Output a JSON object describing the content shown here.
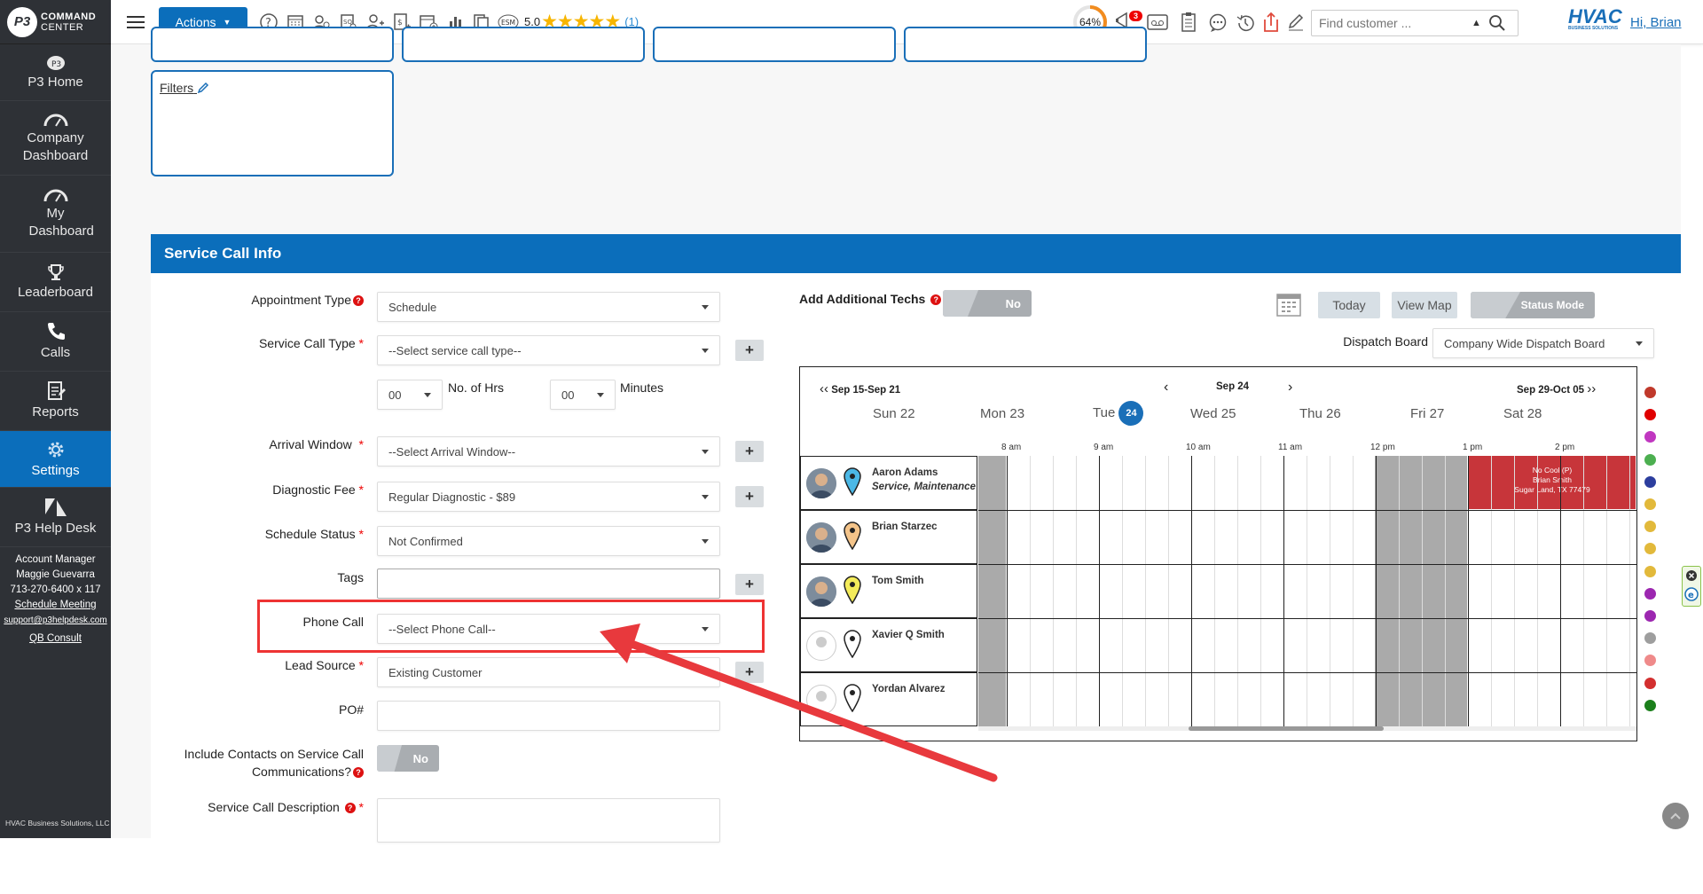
{
  "sidebar": {
    "logo_p3": "P3",
    "logo_line1": "COMMAND",
    "logo_line2": "CENTER",
    "items": [
      {
        "label": "P3 Home"
      },
      {
        "label": "Company Dashboard"
      },
      {
        "label": "My Dashboard"
      },
      {
        "label": "Leaderboard"
      },
      {
        "label": "Calls"
      },
      {
        "label": "Reports"
      },
      {
        "label": "Settings"
      },
      {
        "label": "P3 Help Desk"
      }
    ],
    "account": {
      "title": "Account Manager",
      "name": "Maggie Guevarra",
      "phone": "713-270-6400 x 117",
      "schedule": "Schedule Meeting",
      "email": "support@p3helpdesk.com",
      "qb": "QB Consult"
    },
    "copyright": "HVAC Business Solutions, LLC"
  },
  "topbar": {
    "actions_label": "Actions",
    "rating_value": "5.0",
    "rating_count": "(1)",
    "progress_text": "64%",
    "progress_value": 0.64,
    "notif_count": "3",
    "search_placeholder": "Find customer ...",
    "brand": "HVAC",
    "brand_sub": "BUSINESS SOLUTIONS",
    "greeting": "Hi, Brian"
  },
  "filters": {
    "label": "Filters"
  },
  "section": {
    "title": "Service Call Info"
  },
  "form": {
    "appointment_type": {
      "label": "Appointment Type",
      "value": "Schedule"
    },
    "service_call_type": {
      "label": "Service Call Type",
      "value": "--Select service call type--"
    },
    "hours": {
      "value": "00",
      "label": "No. of Hrs"
    },
    "minutes": {
      "value": "00",
      "label": "Minutes"
    },
    "arrival_window": {
      "label": "Arrival Window",
      "value": "--Select Arrival Window--"
    },
    "diagnostic_fee": {
      "label": "Diagnostic Fee",
      "value": "Regular Diagnostic - $89"
    },
    "schedule_status": {
      "label": "Schedule Status",
      "value": "Not Confirmed"
    },
    "tags": {
      "label": "Tags",
      "value": ""
    },
    "phone_call": {
      "label": "Phone Call",
      "value": "--Select Phone Call--"
    },
    "lead_source": {
      "label": "Lead Source",
      "value": "Existing Customer"
    },
    "po": {
      "label": "PO#",
      "value": ""
    },
    "include_contacts": {
      "label_line1": "Include Contacts on Service Call",
      "label_line2": "Communications?",
      "toggle": "No"
    },
    "description": {
      "label": "Service Call Description"
    }
  },
  "dispatch": {
    "add_techs_label": "Add Additional Techs",
    "add_techs_toggle": "No",
    "today": "Today",
    "view_map": "View Map",
    "status_mode": "Status Mode",
    "board_label": "Dispatch Board",
    "board_value": "Company Wide Dispatch Board",
    "prev_week": "Sep 15-Sep 21",
    "current": "Sep 24",
    "next_week": "Sep 29-Oct 05",
    "days": [
      {
        "name": "Sun",
        "num": "22"
      },
      {
        "name": "Mon",
        "num": "23"
      },
      {
        "name": "Tue",
        "num": "24"
      },
      {
        "name": "Wed",
        "num": "25"
      },
      {
        "name": "Thu",
        "num": "26"
      },
      {
        "name": "Fri",
        "num": "27"
      },
      {
        "name": "Sat",
        "num": "28"
      }
    ],
    "hours": [
      "8 am",
      "9 am",
      "10 am",
      "11 am",
      "12 pm",
      "1 pm",
      "2 pm"
    ],
    "techs": [
      {
        "name": "Aaron Adams",
        "sub": "Service, Maintenance",
        "pin": "#4bb8e6",
        "photo": true
      },
      {
        "name": "Brian Starzec",
        "sub": "",
        "pin": "#f4c48a",
        "photo": true
      },
      {
        "name": "Tom Smith",
        "sub": "",
        "pin": "#f4ec5a",
        "photo": true
      },
      {
        "name": "Xavier Q Smith",
        "sub": "",
        "pin": "#ffffff",
        "photo": false
      },
      {
        "name": "Yordan Alvarez",
        "sub": "",
        "pin": "#ffffff",
        "photo": false
      }
    ],
    "event": {
      "line1": "No Cool (P)",
      "line2": "Brian Smith",
      "line3": "Sugar Land, TX 77479"
    },
    "legend_colors": [
      "#c0392b",
      "#e00000",
      "#c037c0",
      "#4caf50",
      "#2c3e9e",
      "#e2b93b",
      "#e2b93b",
      "#e2b93b",
      "#e2b93b",
      "#9c27b0",
      "#9c27b0",
      "#9e9e9e",
      "#ef8a8a",
      "#d32f2f",
      "#1b7f1b"
    ]
  }
}
